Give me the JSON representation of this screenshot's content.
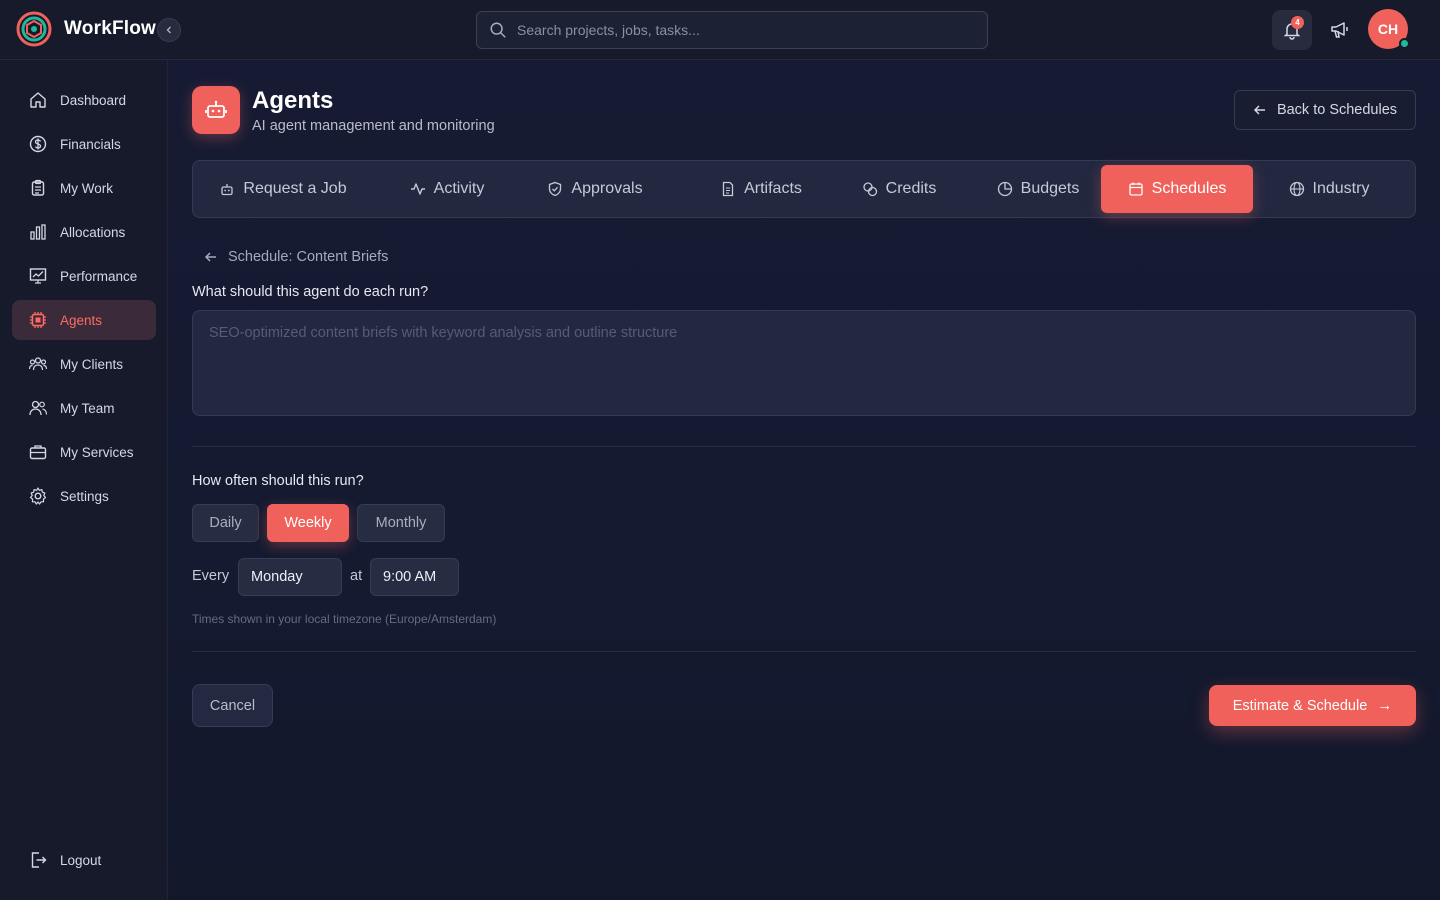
{
  "app": {
    "name": "WorkFlow"
  },
  "colors": {
    "accent": "#f0615b",
    "status_online": "#1fb89b"
  },
  "search": {
    "placeholder": "Search projects, jobs, tasks..."
  },
  "header": {
    "notifications_count": "4",
    "user_initials": "CH"
  },
  "sidebar": {
    "items": [
      {
        "label": "Dashboard",
        "icon": "home-icon"
      },
      {
        "label": "Financials",
        "icon": "dollar-icon"
      },
      {
        "label": "My Work",
        "icon": "clipboard-icon"
      },
      {
        "label": "Allocations",
        "icon": "bar-chart-icon"
      },
      {
        "label": "Performance",
        "icon": "presentation-chart-icon"
      },
      {
        "label": "Agents",
        "icon": "cpu-icon",
        "active": true
      },
      {
        "label": "My Clients",
        "icon": "users-group-icon"
      },
      {
        "label": "My Team",
        "icon": "users-icon"
      },
      {
        "label": "My Services",
        "icon": "briefcase-icon"
      },
      {
        "label": "Settings",
        "icon": "gear-icon"
      }
    ],
    "logout": "Logout"
  },
  "page": {
    "title": "Agents",
    "subtitle": "AI agent management and monitoring",
    "back_label": "Back to Schedules"
  },
  "tabs": [
    {
      "label": "Request a Job",
      "icon": "robot-icon"
    },
    {
      "label": "Activity",
      "icon": "activity-icon"
    },
    {
      "label": "Approvals",
      "icon": "shield-check-icon"
    },
    {
      "label": "Artifacts",
      "icon": "file-icon"
    },
    {
      "label": "Credits",
      "icon": "coins-icon"
    },
    {
      "label": "Budgets",
      "icon": "pie-chart-icon"
    },
    {
      "label": "Schedules",
      "icon": "calendar-icon",
      "active": true
    },
    {
      "label": "Industry",
      "icon": "globe-icon"
    }
  ],
  "form": {
    "breadcrumb": "Schedule: Content Briefs",
    "task_label": "What should this agent do each run?",
    "task_placeholder": "SEO-optimized content briefs with keyword analysis and outline structure",
    "frequency_label": "How often should this run?",
    "frequency_options": [
      "Daily",
      "Weekly",
      "Monthly"
    ],
    "frequency_selected": "Weekly",
    "every_label": "Every",
    "day_value": "Monday",
    "at_label": "at",
    "time_value": "9:00 AM",
    "timezone_note": "Times shown in your local timezone (Europe/Amsterdam)",
    "cancel_label": "Cancel",
    "submit_label": "Estimate & Schedule",
    "submit_arrow": "→"
  }
}
